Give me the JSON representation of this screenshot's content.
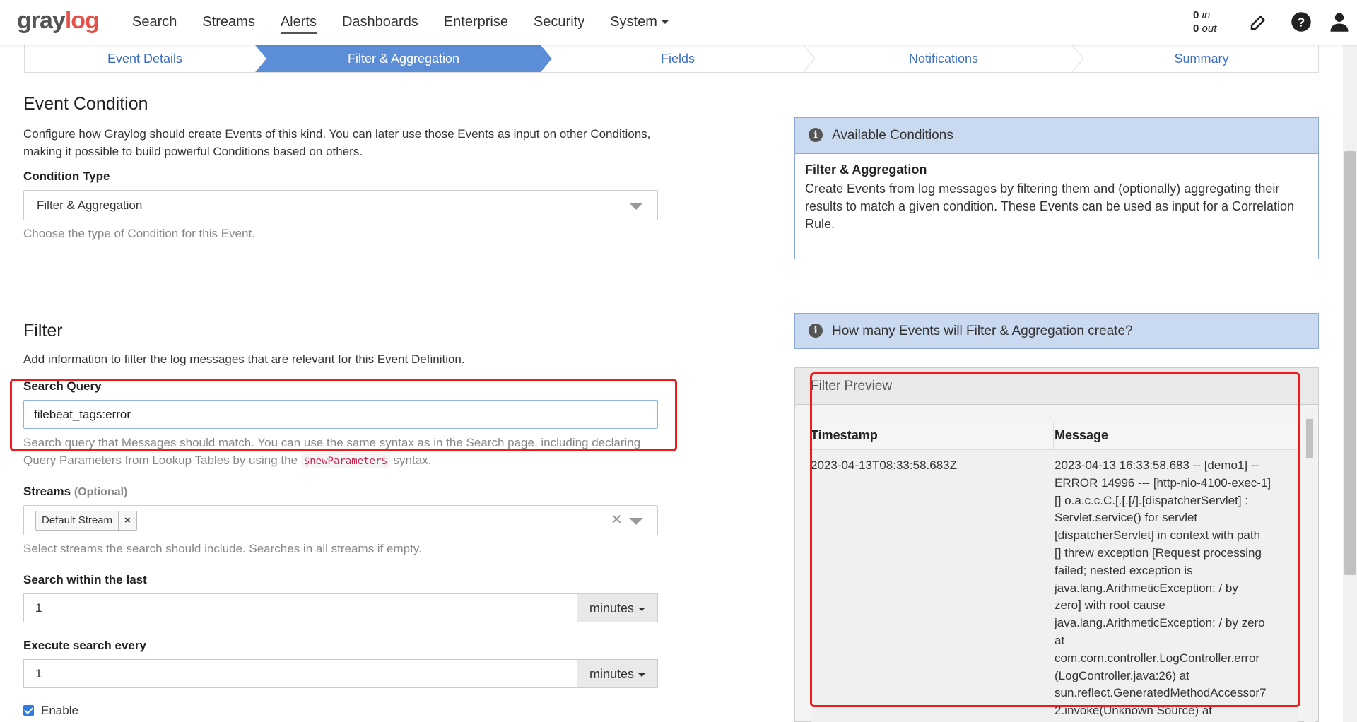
{
  "nav": {
    "logo_left": "gray",
    "logo_right": "log",
    "items": [
      {
        "label": "Search"
      },
      {
        "label": "Streams"
      },
      {
        "label": "Alerts"
      },
      {
        "label": "Dashboards"
      },
      {
        "label": "Enterprise"
      },
      {
        "label": "Security"
      },
      {
        "label": "System"
      }
    ],
    "throughput_in_value": "0",
    "throughput_in_label": "in",
    "throughput_out_value": "0",
    "throughput_out_label": "out",
    "icons": [
      "edit-icon",
      "help-icon",
      "user-icon"
    ]
  },
  "wizard": {
    "steps": [
      {
        "label": "Event Details"
      },
      {
        "label": "Filter & Aggregation"
      },
      {
        "label": "Fields"
      },
      {
        "label": "Notifications"
      },
      {
        "label": "Summary"
      }
    ],
    "active_index": 1
  },
  "event_condition": {
    "title": "Event Condition",
    "description": "Configure how Graylog should create Events of this kind. You can later use those Events as input on other Conditions, making it possible to build powerful Conditions based on others.",
    "condition_type_label": "Condition Type",
    "condition_type_value": "Filter & Aggregation",
    "condition_type_help": "Choose the type of Condition for this Event."
  },
  "available_conditions": {
    "header": "Available Conditions",
    "title": "Filter & Aggregation",
    "body": "Create Events from log messages by filtering them and (optionally) aggregating their results to match a given condition. These Events can be used as input for a Correlation Rule."
  },
  "filter": {
    "title": "Filter",
    "description": "Add information to filter the log messages that are relevant for this Event Definition.",
    "search_query_label": "Search Query",
    "search_query_value": "filebeat_tags:error",
    "search_query_help_1": "Search query that Messages should match. You can use the same syntax as in the Search page, including declaring Query Parameters from Lookup Tables by using the",
    "search_query_help_code": "$newParameter$",
    "search_query_help_2": "syntax.",
    "streams_label": "Streams",
    "streams_optional": "(Optional)",
    "streams_selected": "Default Stream",
    "streams_help": "Select streams the search should include. Searches in all streams if empty.",
    "search_within_label": "Search within the last",
    "search_within_value": "1",
    "search_within_unit": "minutes",
    "execute_every_label": "Execute search every",
    "execute_every_value": "1",
    "execute_every_unit": "minutes",
    "enable_label": "Enable",
    "enable_checked": true
  },
  "events_panel": {
    "header": "How many Events will Filter & Aggregation create?"
  },
  "filter_preview": {
    "header": "Filter Preview",
    "columns": [
      "Timestamp",
      "Message"
    ],
    "rows": [
      {
        "timestamp": "2023-04-13T08:33:58.683Z",
        "message_lines": [
          "2023-04-13 16:33:58.683 -- [demo1] --",
          "ERROR 14996 --- [http-nio-4100-exec-1]",
          "[] o.a.c.c.C.[.[.[/].[dispatcherServlet] :",
          "Servlet.service() for servlet",
          "[dispatcherServlet] in context with path",
          "[] threw exception [Request processing",
          "failed; nested exception is",
          "java.lang.ArithmeticException: / by",
          "zero] with root cause",
          "java.lang.ArithmeticException: / by zero",
          "at",
          "com.corn.controller.LogController.error",
          "(LogController.java:26) at",
          "sun.reflect.GeneratedMethodAccessor7",
          "2.invoke(Unknown Source) at"
        ]
      }
    ]
  },
  "colors": {
    "accent": "#5b8ed6",
    "link": "#3b6ec9",
    "highlight": "#ee1c1c",
    "logo_accent": "#e8514a"
  }
}
